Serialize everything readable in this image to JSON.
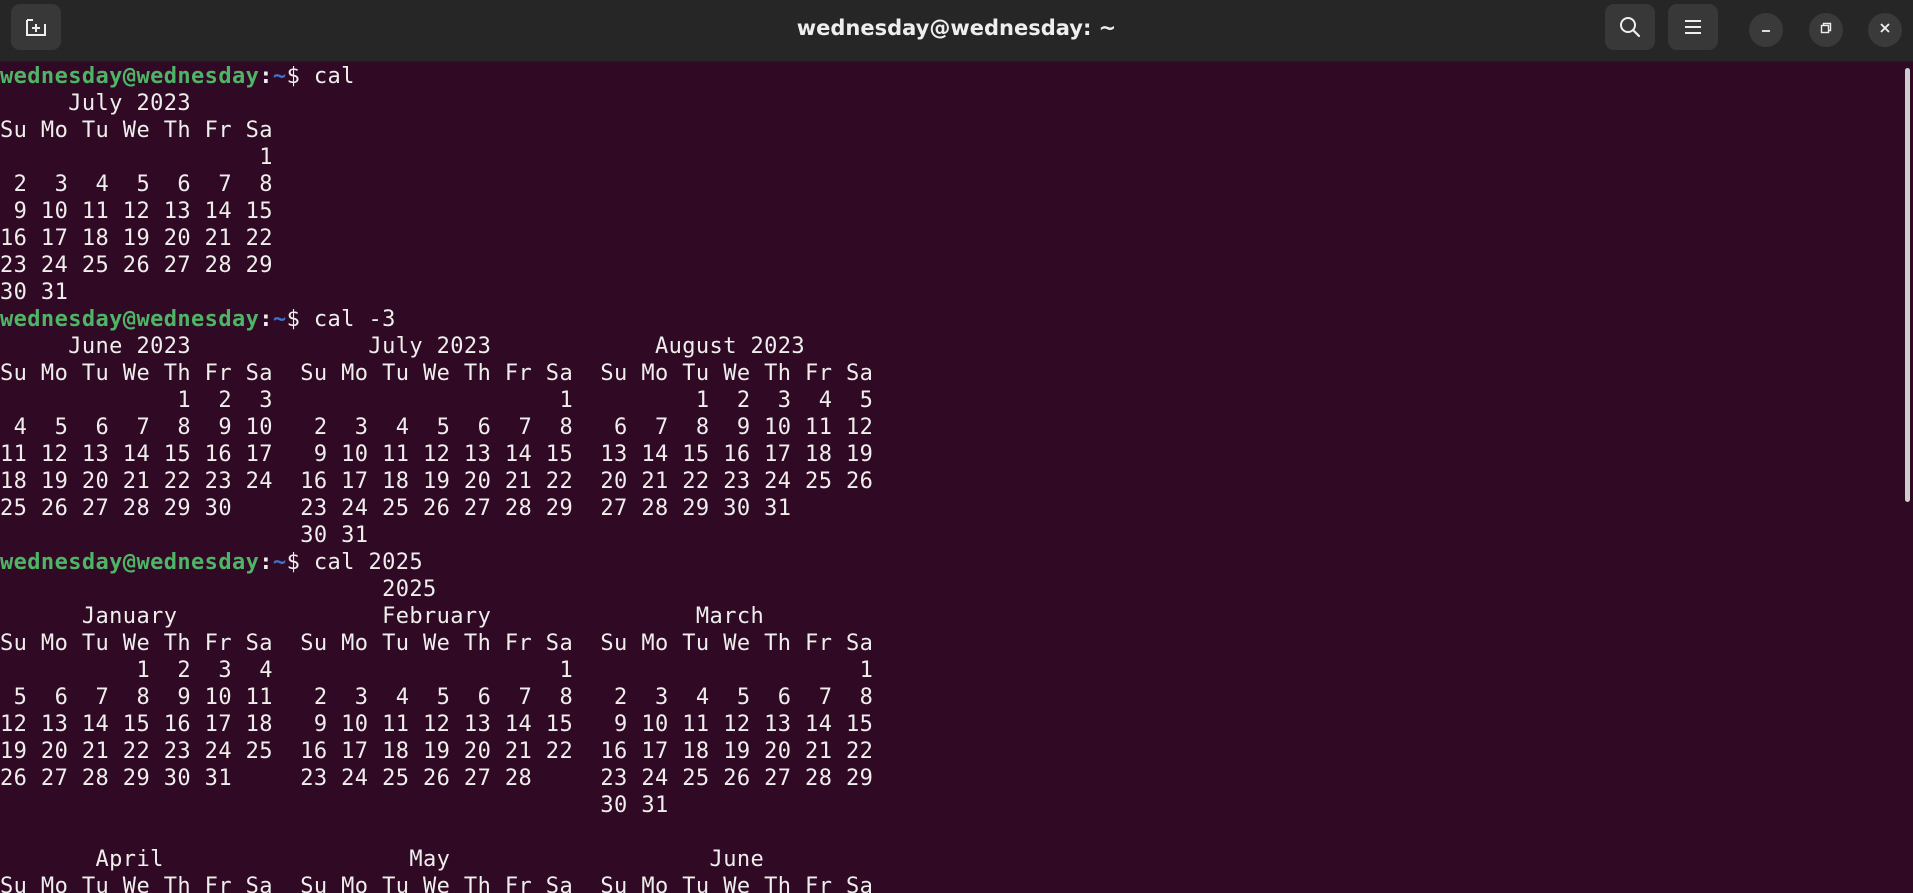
{
  "window": {
    "title": "wednesday@wednesday: ~"
  },
  "icons": {
    "new_tab": "new-tab-icon",
    "search": "search-icon",
    "menu": "hamburger-menu-icon",
    "minimize": "minimize-icon",
    "maximize": "restore-icon",
    "close": "close-icon"
  },
  "prompt": {
    "user_host": "wednesday@wednesday",
    "colon": ":",
    "path": "~",
    "dollar": "$ "
  },
  "colors": {
    "background": "#300a24",
    "prompt_user": "#4eb566",
    "prompt_path": "#3f72c9",
    "text": "#eeeeec"
  },
  "terminal": {
    "lines": [
      {
        "type": "prompt",
        "cmd": "cal"
      },
      {
        "type": "out",
        "text": "     July 2023"
      },
      {
        "type": "out",
        "text": "Su Mo Tu We Th Fr Sa"
      },
      {
        "type": "out",
        "text": "                   1"
      },
      {
        "type": "out",
        "text": " 2  3  4  5  6  7  8"
      },
      {
        "type": "out",
        "text": " 9 10 11 12 13 14 15"
      },
      {
        "type": "out",
        "text": "16 17 18 19 20 21 22"
      },
      {
        "type": "out",
        "text": "23 24 25 26 27 28 29"
      },
      {
        "type": "out",
        "text": "30 31"
      },
      {
        "type": "prompt",
        "cmd": "cal -3"
      },
      {
        "type": "out",
        "text": "     June 2023             July 2023            August 2023"
      },
      {
        "type": "out",
        "text": "Su Mo Tu We Th Fr Sa  Su Mo Tu We Th Fr Sa  Su Mo Tu We Th Fr Sa"
      },
      {
        "type": "out",
        "text": "             1  2  3                     1         1  2  3  4  5"
      },
      {
        "type": "out",
        "text": " 4  5  6  7  8  9 10   2  3  4  5  6  7  8   6  7  8  9 10 11 12"
      },
      {
        "type": "out",
        "text": "11 12 13 14 15 16 17   9 10 11 12 13 14 15  13 14 15 16 17 18 19"
      },
      {
        "type": "out",
        "text": "18 19 20 21 22 23 24  16 17 18 19 20 21 22  20 21 22 23 24 25 26"
      },
      {
        "type": "out",
        "text": "25 26 27 28 29 30     23 24 25 26 27 28 29  27 28 29 30 31"
      },
      {
        "type": "out",
        "text": "                      30 31"
      },
      {
        "type": "prompt",
        "cmd": "cal 2025"
      },
      {
        "type": "out",
        "text": "                            2025"
      },
      {
        "type": "out",
        "text": "      January               February               March"
      },
      {
        "type": "out",
        "text": "Su Mo Tu We Th Fr Sa  Su Mo Tu We Th Fr Sa  Su Mo Tu We Th Fr Sa"
      },
      {
        "type": "out",
        "text": "          1  2  3  4                     1                     1"
      },
      {
        "type": "out",
        "text": " 5  6  7  8  9 10 11   2  3  4  5  6  7  8   2  3  4  5  6  7  8"
      },
      {
        "type": "out",
        "text": "12 13 14 15 16 17 18   9 10 11 12 13 14 15   9 10 11 12 13 14 15"
      },
      {
        "type": "out",
        "text": "19 20 21 22 23 24 25  16 17 18 19 20 21 22  16 17 18 19 20 21 22"
      },
      {
        "type": "out",
        "text": "26 27 28 29 30 31     23 24 25 26 27 28     23 24 25 26 27 28 29"
      },
      {
        "type": "out",
        "text": "                                            30 31"
      },
      {
        "type": "out",
        "text": ""
      },
      {
        "type": "out",
        "text": "       April                  May                   June"
      },
      {
        "type": "out",
        "text": "Su Mo Tu We Th Fr Sa  Su Mo Tu We Th Fr Sa  Su Mo Tu We Th Fr Sa"
      }
    ]
  }
}
